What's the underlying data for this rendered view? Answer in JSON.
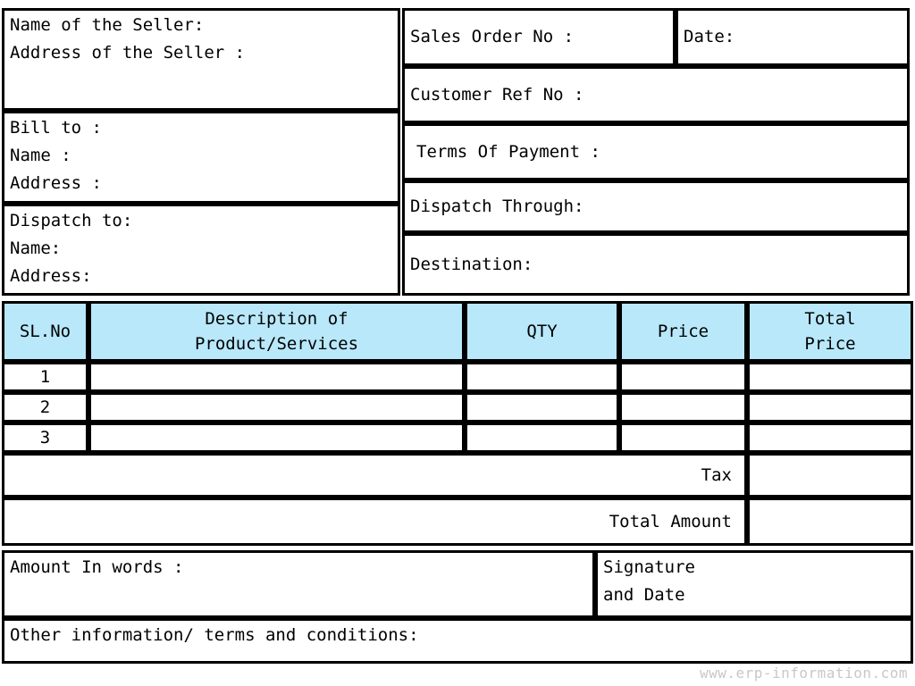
{
  "document": {
    "type": "sales-invoice-template",
    "watermark": "www.erp-information.com"
  },
  "seller_block": {
    "text": "Name of the Seller:\nAddress of the Seller :"
  },
  "bill_to_block": {
    "text": "Bill to :\nName :\nAddress :"
  },
  "dispatch_to_block": {
    "text": "Dispatch to:\nName:\nAddress:"
  },
  "order_fields": {
    "sales_order_no": "Sales Order No :",
    "date": "Date:",
    "customer_ref_no": "Customer Ref No :",
    "terms_of_payment": "Terms Of Payment :",
    "dispatch_through": "Dispatch Through:",
    "destination": "Destination:"
  },
  "items_table": {
    "header_color": "#b8e8fa",
    "columns": [
      {
        "key": "sl_no",
        "label": "SL.No"
      },
      {
        "key": "description",
        "label": "Description of\nProduct/Services"
      },
      {
        "key": "qty",
        "label": "QTY"
      },
      {
        "key": "price",
        "label": "Price"
      },
      {
        "key": "total_price",
        "label": "Total\nPrice"
      }
    ],
    "rows": [
      {
        "sl_no": "1",
        "description": "",
        "qty": "",
        "price": "",
        "total_price": ""
      },
      {
        "sl_no": "2",
        "description": "",
        "qty": "",
        "price": "",
        "total_price": ""
      },
      {
        "sl_no": "3",
        "description": "",
        "qty": "",
        "price": "",
        "total_price": ""
      }
    ]
  },
  "totals": {
    "tax_label": "Tax",
    "tax_value": "",
    "total_amount_label": "Total Amount",
    "total_amount_value": ""
  },
  "footer": {
    "amount_in_words": "Amount In words :",
    "signature_and_date": "Signature\n and Date",
    "other_information": "Other information/ terms and conditions:"
  }
}
